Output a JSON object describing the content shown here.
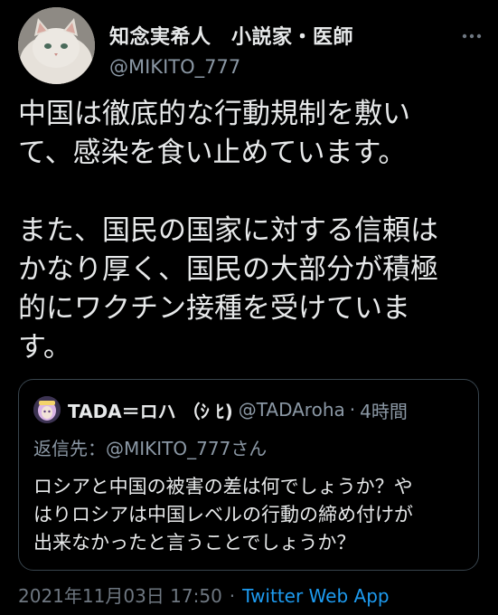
{
  "author": {
    "display_name": "知念実希人　小説家・医師",
    "handle": "@MIKITO_777"
  },
  "tweet": {
    "paragraphs": [
      "中国は徹底的な行動規制を敷い\nて、感染を食い止めています。",
      "また、国民の国家に対する信頼は\nかなり厚く、国民の大部分が積極\n的にワクチン接種を受けていま\nす。"
    ]
  },
  "quote": {
    "display_name": "TADA＝ロハ （ｼ ﾋ)",
    "handle": "@TADAroha",
    "separator": "·",
    "time": "4時間",
    "reply_to_label": "返信先：",
    "reply_to_handle": "@MIKITO_777",
    "reply_to_suffix": "さん",
    "text": "ロシアと中国の被害の差は何でしょうか？や\nはりロシアは中国レベルの行動の締め付けが\n出来なかったと言うことでしょうか？"
  },
  "footer": {
    "timestamp": "2021年11月03日 17:50",
    "separator": "·",
    "source": "Twitter Web App"
  },
  "colors": {
    "background": "#000000",
    "primary_text": "#e7e9ea",
    "secondary_text": "#8b98a5",
    "link": "#1d9bf0",
    "border": "#38444d"
  },
  "icons": {
    "more": "more-options-icon",
    "avatar": "cat-avatar",
    "quote_avatar": "anime-avatar"
  }
}
